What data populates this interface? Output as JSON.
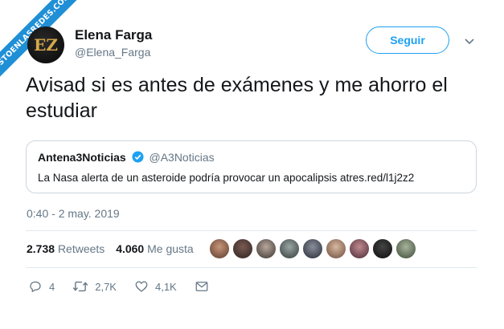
{
  "watermark": {
    "text": "VISTOENLASREDES.COM"
  },
  "author": {
    "name": "Elena Farga",
    "handle": "@Elena_Farga",
    "avatar_initials": "EZ"
  },
  "follow_label": "Seguir",
  "tweet": {
    "text": "Avisad si es antes de exámenes y me ahorro el estudiar"
  },
  "quote": {
    "name": "Antena3Noticias",
    "handle": "@A3Noticias",
    "text": "La Nasa alerta de un asteroide podría provocar un apocalipsis atres.red/l1j2z2"
  },
  "timestamp": "0:40 - 2 may. 2019",
  "stats": {
    "retweets_count": "2.738",
    "retweets_label": "Retweets",
    "likes_count": "4.060",
    "likes_label": "Me gusta"
  },
  "actions": {
    "reply_count": "4",
    "retweet_count": "2,7K",
    "like_count": "4,1K"
  },
  "colors": {
    "accent": "#1da1f2",
    "ribbon": "#1f8fd6",
    "muted": "#657786"
  },
  "icons": [
    "chevron-down-icon",
    "verified-icon",
    "reply-icon",
    "retweet-icon",
    "like-icon",
    "message-icon"
  ]
}
